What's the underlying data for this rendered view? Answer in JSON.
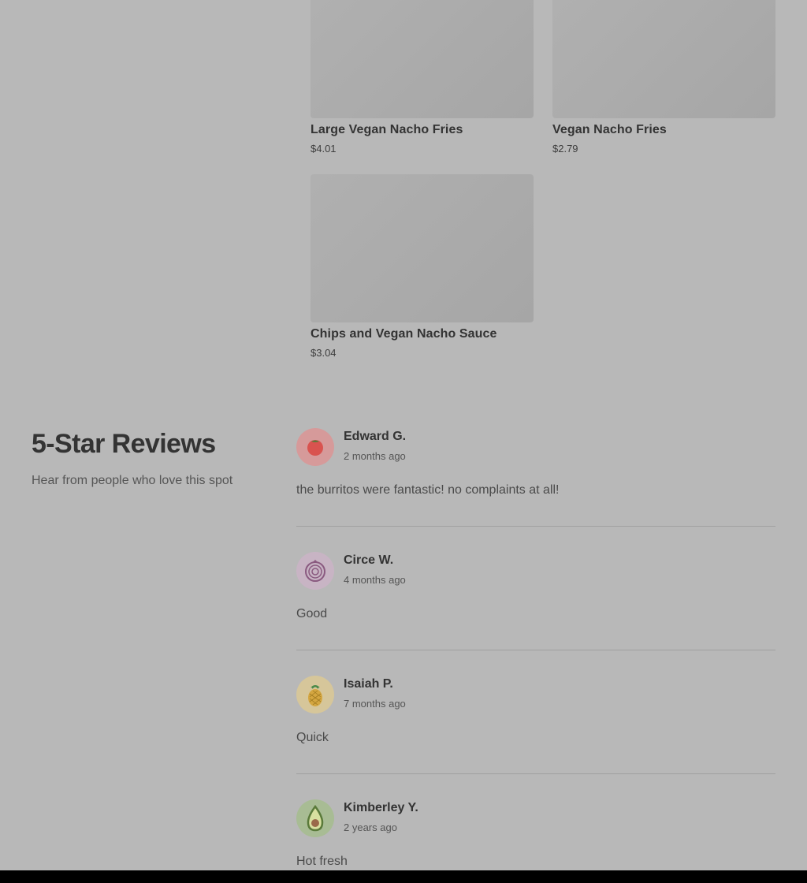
{
  "menu_items": [
    {
      "name": "Large Vegan Nacho Fries",
      "price": "$4.01"
    },
    {
      "name": "Vegan Nacho Fries",
      "price": "$2.79"
    },
    {
      "name": "Chips and Vegan Nacho Sauce",
      "price": "$3.04"
    }
  ],
  "reviews_section": {
    "title": "5-Star Reviews",
    "subtitle": "Hear from people who love this spot",
    "reviews": [
      {
        "author": "Edward G.",
        "date": "2 months ago",
        "text": "the burritos were fantastic! no complaints at all!",
        "avatar_icon": "tomato-icon",
        "avatar_color": "#d69a9a"
      },
      {
        "author": "Circe W.",
        "date": "4 months ago",
        "text": "Good",
        "avatar_icon": "onion-icon",
        "avatar_color": "#c8b4c4"
      },
      {
        "author": "Isaiah P.",
        "date": "7 months ago",
        "text": "Quick",
        "avatar_icon": "pineapple-icon",
        "avatar_color": "#d6c69a"
      },
      {
        "author": "Kimberley Y.",
        "date": "2 years ago",
        "text": "Hot fresh",
        "avatar_icon": "avocado-icon",
        "avatar_color": "#a8bc94"
      }
    ]
  },
  "colors": {
    "overlay_background": "#b8b8b8",
    "text_primary": "#333333"
  }
}
